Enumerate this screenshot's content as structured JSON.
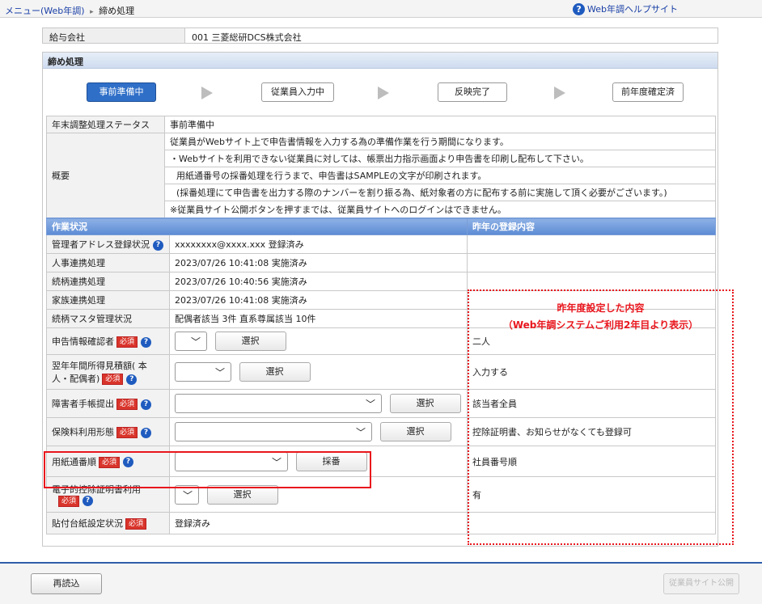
{
  "breadcrumb": {
    "menu_link": "メニュー(Web年調)",
    "current": "締め処理"
  },
  "help": {
    "label": "Web年調ヘルプサイト"
  },
  "company": {
    "label": "給与会社",
    "value": "001 三菱総研DCS株式会社"
  },
  "section": {
    "title": "締め処理"
  },
  "steps": [
    {
      "label": "事前準備中",
      "active": true
    },
    {
      "label": "従業員入力中",
      "active": false
    },
    {
      "label": "反映完了",
      "active": false
    },
    {
      "label": "前年度確定済",
      "active": false
    }
  ],
  "status": {
    "label": "年末調整処理ステータス",
    "value": "事前準備中"
  },
  "overview": {
    "label": "概要",
    "lines": [
      "従業員がWebサイト上で申告書情報を入力する為の準備作業を行う期間になります。",
      "・Webサイトを利用できない従業員に対しては、帳票出力指示画面より申告書を印刷し配布して下さい。",
      "用紙通番号の採番処理を行うまで、申告書はSAMPLEの文字が印刷されます。",
      "(採番処理にて申告書を出力する際のナンバーを割り振る為、紙対象者の方に配布する前に実施して頂く必要がございます。)",
      "※従業員サイト公開ボタンを押すまでは、従業員サイトへのログインはできません。"
    ]
  },
  "work": {
    "header_left": "作業状況",
    "header_right": "昨年の登録内容",
    "required_badge": "必須",
    "select_label": "選択",
    "number_label": "採番",
    "rows": [
      {
        "label": "管理者アドレス登録状況",
        "value": "xxxxxxxx@xxxx.xxx  登録済み",
        "prev": ""
      },
      {
        "label": "人事連携処理",
        "value": "2023/07/26 10:41:08  実施済み",
        "prev": ""
      },
      {
        "label": "続柄連携処理",
        "value": "2023/07/26 10:40:56  実施済み",
        "prev": ""
      },
      {
        "label": "家族連携処理",
        "value": "2023/07/26 10:41:08  実施済み",
        "prev": ""
      },
      {
        "label": "続柄マスタ管理状況",
        "value": "配偶者該当 3件  直系尊属該当 10件",
        "prev": ""
      },
      {
        "label": "申告情報確認者",
        "prev": "二人"
      },
      {
        "label_line1": "翌年年間所得見積額( 本",
        "label_line2": "人・配偶者)",
        "prev": "入力する"
      },
      {
        "label": "障害者手帳提出",
        "prev": "該当者全員"
      },
      {
        "label": "保険料利用形態",
        "prev": "控除証明書、お知らせがなくても登録可"
      },
      {
        "label": "用紙通番順",
        "prev": "社員番号順"
      },
      {
        "label": "電子的控除証明書利用",
        "prev": "有"
      },
      {
        "label": "貼付台紙設定状況",
        "value": "登録済み",
        "prev": ""
      }
    ]
  },
  "annotation": {
    "line1": "昨年度設定した内容",
    "line2": "（Web年調システムご利用2年目より表示）"
  },
  "footer": {
    "reload": "再読込",
    "publish": "従業員サイト公開"
  },
  "colors": {
    "accent": "#2f6fc8",
    "annotation": "#e8161d"
  }
}
